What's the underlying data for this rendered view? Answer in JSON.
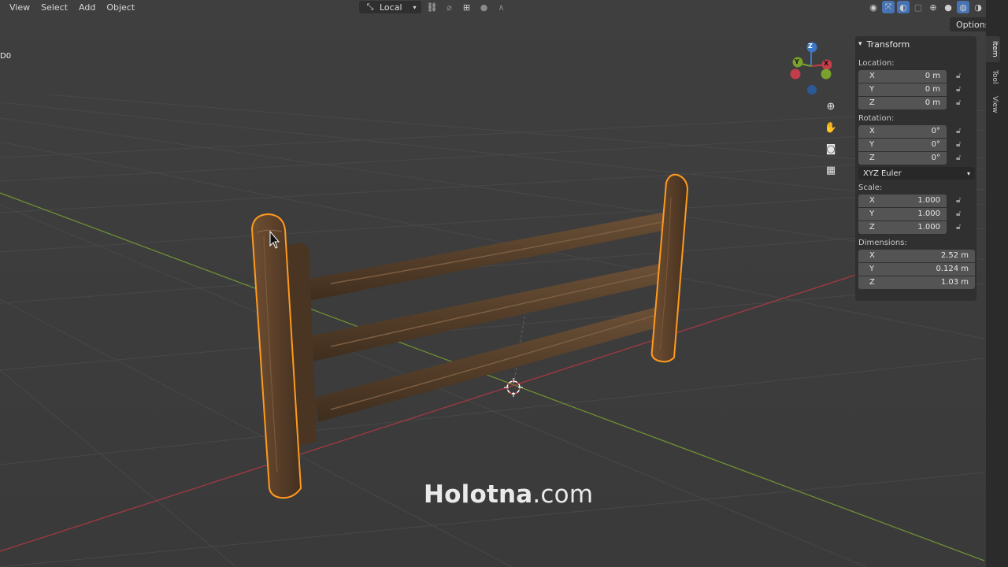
{
  "header": {
    "menus": [
      "View",
      "Select",
      "Add",
      "Object"
    ],
    "transform_orientation": "Local",
    "options_label": "Options"
  },
  "viewport": {
    "object_label": "D0",
    "gizmo_axes": [
      "Z",
      "Y",
      "X"
    ],
    "nav_icons": [
      "zoom-icon",
      "pan-hand-icon",
      "camera-icon",
      "grid-icon"
    ]
  },
  "npanel": {
    "title": "Transform",
    "location_label": "Location:",
    "location": [
      {
        "axis": "X",
        "value": "0 m"
      },
      {
        "axis": "Y",
        "value": "0 m"
      },
      {
        "axis": "Z",
        "value": "0 m"
      }
    ],
    "rotation_label": "Rotation:",
    "rotation": [
      {
        "axis": "X",
        "value": "0°"
      },
      {
        "axis": "Y",
        "value": "0°"
      },
      {
        "axis": "Z",
        "value": "0°"
      }
    ],
    "rotation_mode": "XYZ Euler",
    "scale_label": "Scale:",
    "scale": [
      {
        "axis": "X",
        "value": "1.000"
      },
      {
        "axis": "Y",
        "value": "1.000"
      },
      {
        "axis": "Z",
        "value": "1.000"
      }
    ],
    "dimensions_label": "Dimensions:",
    "dimensions": [
      {
        "axis": "X",
        "value": "2.52 m"
      },
      {
        "axis": "Y",
        "value": "0.124 m"
      },
      {
        "axis": "Z",
        "value": "1.03 m"
      }
    ]
  },
  "side_tabs": [
    "Item",
    "Tool",
    "View"
  ],
  "watermark": {
    "brand": "Holotna",
    "suffix": ".com"
  },
  "colors": {
    "selection_outline": "#ff9a1f",
    "x_axis": "#c33d4a",
    "y_axis": "#7aa12d",
    "z_axis": "#3b78c6",
    "background": "#3d3d3d"
  }
}
